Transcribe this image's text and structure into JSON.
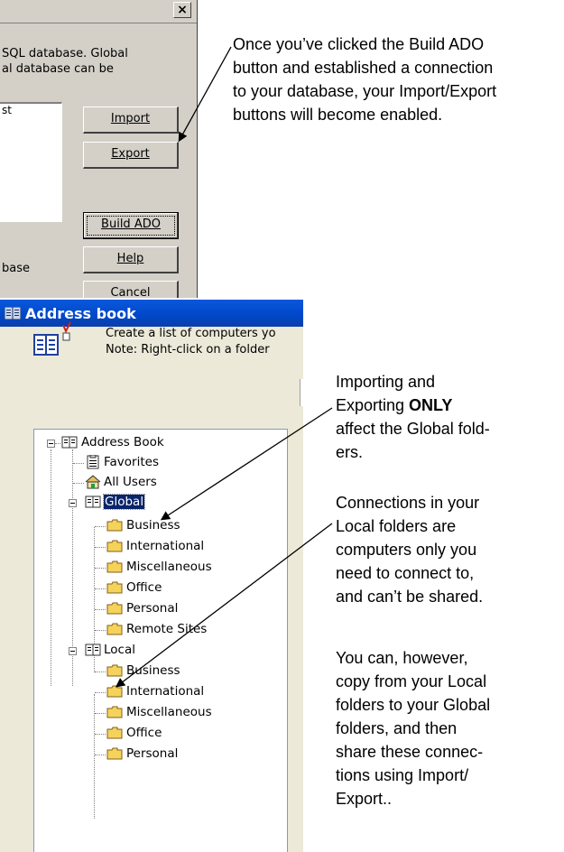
{
  "top_dialog": {
    "close_glyph": "×",
    "description_line1": "SQL database.  Global",
    "description_line2": "al database can be",
    "list_text": "st",
    "import_label": "Import",
    "export_label": "Export",
    "build_ado_label": "Build ADO",
    "help_label": "Help",
    "cancel_label": "Cancel",
    "footer_text": "base"
  },
  "address_book": {
    "title": "Address book",
    "info_line1": "Create a list of computers yo",
    "info_line2": "Note: Right-click on a folder",
    "tree": {
      "root": "Address Book",
      "favorites": "Favorites",
      "all_users": "All Users",
      "global": {
        "label": "Global",
        "children": [
          "Business",
          "International",
          "Miscellaneous",
          "Office",
          "Personal",
          "Remote Sites"
        ]
      },
      "local": {
        "label": "Local",
        "children": [
          "Business",
          "International",
          "Miscellaneous",
          "Office",
          "Personal"
        ]
      }
    }
  },
  "annotations": {
    "note1": [
      "Once you’ve clicked the Build ADO",
      "button and established a connection",
      "to your database, your Import/Export",
      "buttons will become enabled."
    ],
    "note2_line1": "Importing and",
    "note2_line2_pre": "Exporting ",
    "note2_line2_bold": "ONLY",
    "note2_line3": "affect the Global fold-",
    "note2_line4": "ers.",
    "note3": [
      "Connections in your",
      "Local folders are",
      "computers only you",
      "need to connect to,",
      "and can’t be shared."
    ],
    "note4": [
      "You can, however,",
      "copy from your Local",
      "folders to your Global",
      "folders, and then",
      "share these connec-",
      "tions using Import/",
      "Export.."
    ]
  },
  "colors": {
    "dialog_face": "#d4d0c8",
    "xp_face": "#ece9d8",
    "title_blue": "#0a58dd",
    "selection": "#0a246a",
    "folder_yellow": "#f5d35a"
  }
}
